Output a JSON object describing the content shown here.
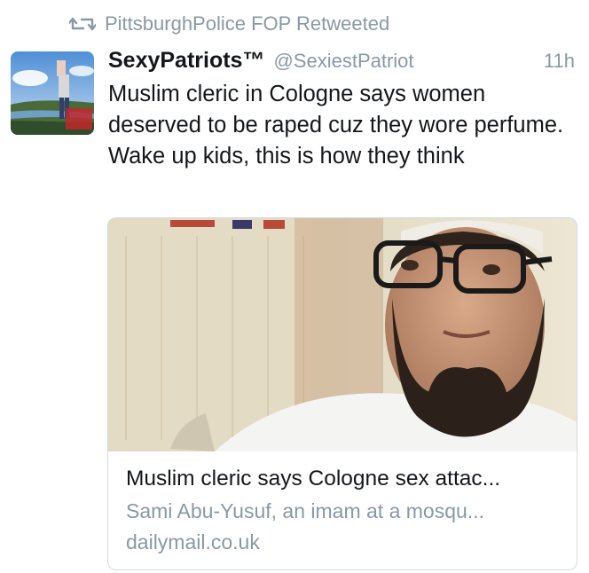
{
  "retweet": {
    "icon": "retweet-icon",
    "text": "PittsburghPolice FOP Retweeted"
  },
  "tweet": {
    "display_name": "SexyPatriots™",
    "handle": "@SexiestPatriot",
    "timestamp": "11h",
    "text": "Muslim cleric in Cologne says women deserved to be raped cuz they wore perfume. Wake up kids, this is how they think"
  },
  "card": {
    "title": "Muslim cleric says Cologne sex attac...",
    "description": "Sami Abu-Yusuf, an imam at a mosqu...",
    "domain": "dailymail.co.uk"
  },
  "colors": {
    "secondary_text": "#8899a6",
    "primary_text": "#14171a",
    "card_border": "#d2dbe3"
  }
}
